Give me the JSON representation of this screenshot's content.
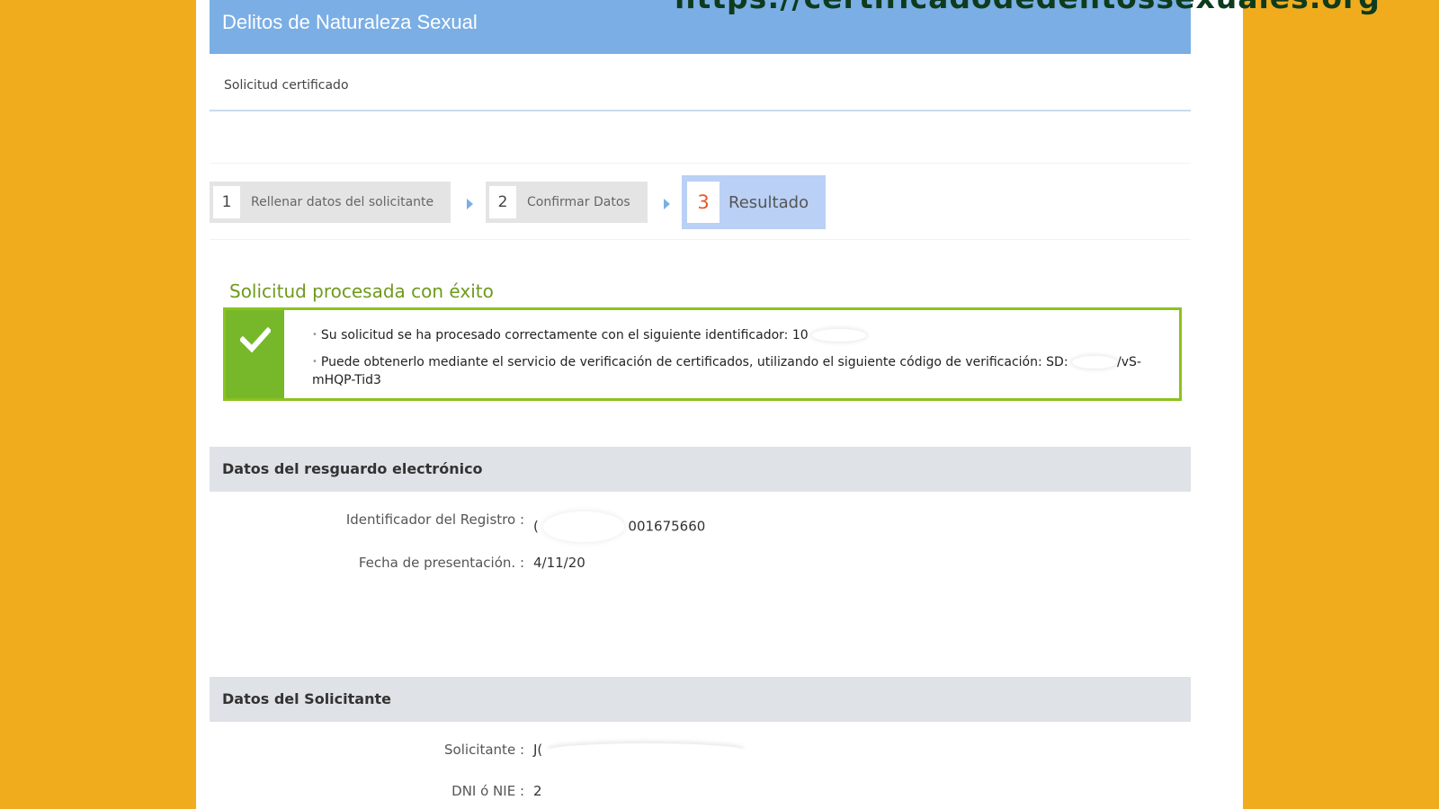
{
  "header": {
    "title": "Delitos de Naturaleza Sexual",
    "site_url": "https://certificadodedelitossexuales.org"
  },
  "page_subtitle": "Solicitud certificado",
  "steps": [
    {
      "number": "1",
      "label": "Rellenar datos del solicitante",
      "active": false
    },
    {
      "number": "2",
      "label": "Confirmar Datos",
      "active": false
    },
    {
      "number": "3",
      "label": "Resultado",
      "active": true
    }
  ],
  "success": {
    "heading": "Solicitud procesada con éxito",
    "message_1": "Su solicitud se ha procesado correctamente con el siguiente identificador: 10",
    "message_2_a": "Puede obtenerlo mediante el servicio de verificación de certificados, utilizando el siguiente código de verificación: SD:",
    "message_2_b": "/vS-mHQP-Tid3",
    "icon": "check-icon"
  },
  "resguardo": {
    "title": "Datos del resguardo electrónico",
    "registro_label": "Identificador del Registro :",
    "registro_value_prefix": "(",
    "registro_value_suffix": "001675660",
    "fecha_label": "Fecha de presentación. :",
    "fecha_value": "4/11/20"
  },
  "solicitante": {
    "title": "Datos del Solicitante",
    "solicitante_label": "Solicitante :",
    "solicitante_value": "J(",
    "dni_label": "DNI ó NIE :",
    "dni_value": "2"
  },
  "colors": {
    "background": "#f1ac1e",
    "header": "#7aaee5",
    "success_green": "#76b82a",
    "active_step": "#bad0f5",
    "active_step_number": "#e35b2a"
  }
}
